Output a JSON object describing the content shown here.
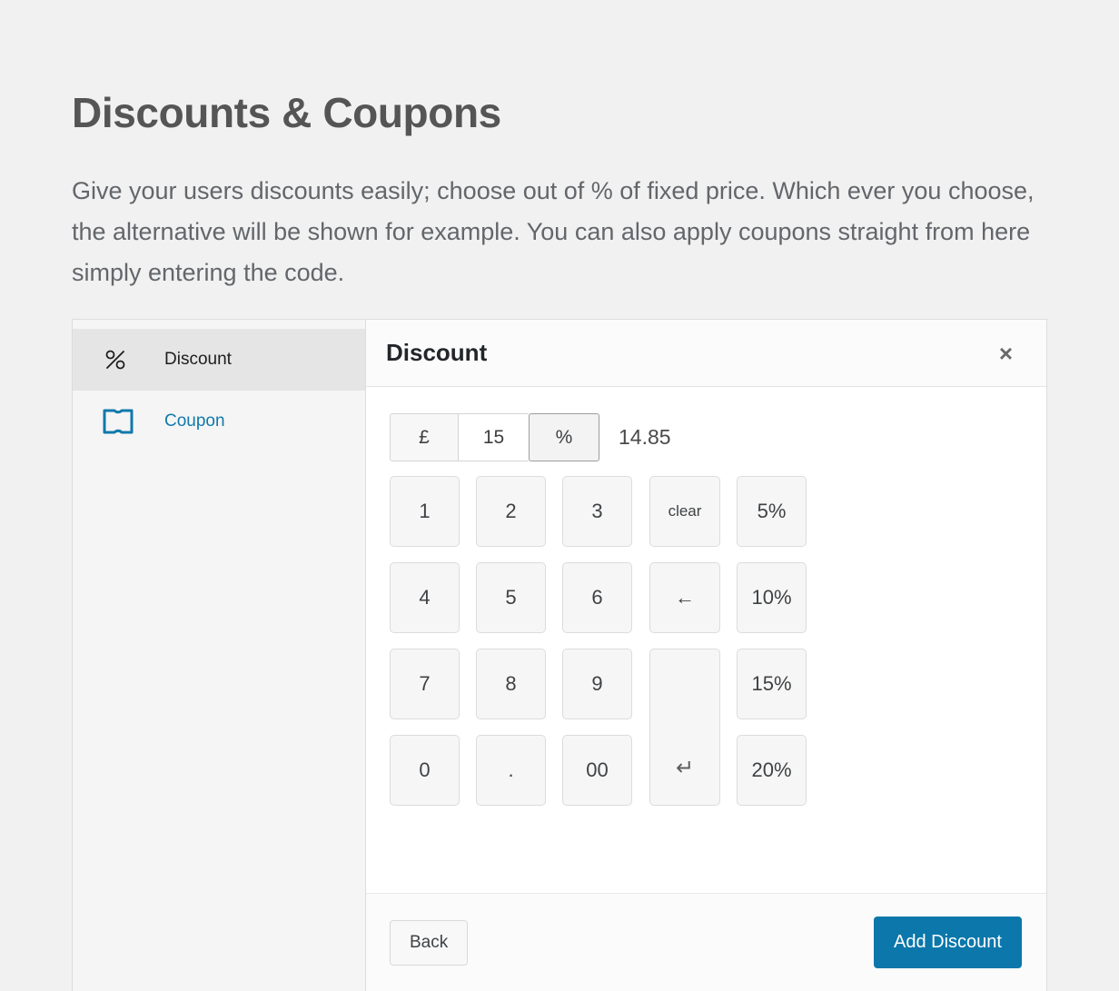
{
  "page": {
    "title": "Discounts & Coupons",
    "intro": "Give your users discounts easily; choose out of % of fixed price. Which ever you choose, the alternative will be shown for example. You can also apply coupons straight from here simply entering the code."
  },
  "colors": {
    "page_background": "#f1f1f1",
    "accent_blue": "#0b77ab",
    "link_blue": "#1179ab",
    "heading_gray": "#555555",
    "sidebar_background": "#f5f5f5",
    "sidebar_active_background": "#e5e5e5",
    "key_background": "#f6f6f6",
    "key_border": "#dcdcdc"
  },
  "sidebar": {
    "items": [
      {
        "label": "Discount",
        "icon": "percent-icon",
        "active": true
      },
      {
        "label": "Coupon",
        "icon": "ticket-icon",
        "active": false
      }
    ]
  },
  "panel": {
    "title": "Discount",
    "close_label": "×",
    "amount": {
      "currency_symbol": "£",
      "value": "15",
      "percent_symbol": "%",
      "selected_mode": "%",
      "converted_value": "14.85"
    },
    "keypad": {
      "keys": [
        {
          "label": "1",
          "name": "key-1"
        },
        {
          "label": "2",
          "name": "key-2"
        },
        {
          "label": "3",
          "name": "key-3"
        },
        {
          "label": "clear",
          "name": "key-clear"
        },
        {
          "label": "5%",
          "name": "key-preset-5"
        },
        {
          "label": "4",
          "name": "key-4"
        },
        {
          "label": "5",
          "name": "key-5"
        },
        {
          "label": "6",
          "name": "key-6"
        },
        {
          "label": "←",
          "name": "key-backspace"
        },
        {
          "label": "10%",
          "name": "key-preset-10"
        },
        {
          "label": "7",
          "name": "key-7"
        },
        {
          "label": "8",
          "name": "key-8"
        },
        {
          "label": "9",
          "name": "key-9"
        },
        {
          "label": "15%",
          "name": "key-preset-15"
        },
        {
          "label": "0",
          "name": "key-0"
        },
        {
          "label": ".",
          "name": "key-decimal"
        },
        {
          "label": "00",
          "name": "key-double-zero"
        },
        {
          "label": "20%",
          "name": "key-preset-20"
        },
        {
          "label": "↵",
          "name": "key-enter"
        }
      ]
    },
    "footer": {
      "back_label": "Back",
      "submit_label": "Add Discount"
    }
  }
}
